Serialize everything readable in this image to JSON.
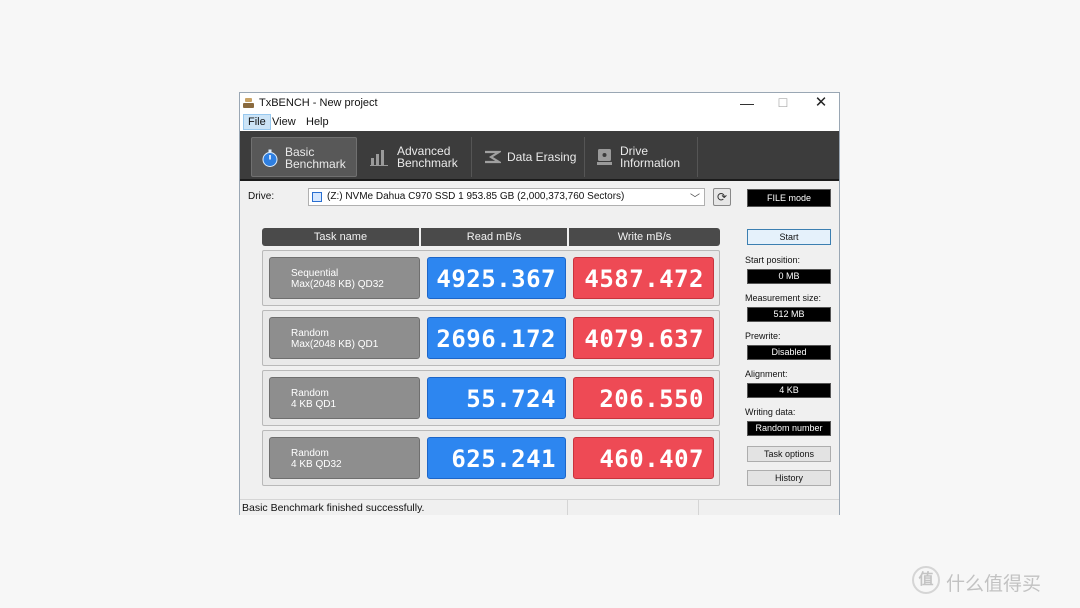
{
  "window": {
    "title": "TxBENCH - New project",
    "minimize": "—",
    "maximize": "☐",
    "close": "✕"
  },
  "menu": [
    "File",
    "View",
    "Help"
  ],
  "tabs": [
    {
      "label": "Basic\nBenchmark",
      "icon": "stopwatch-icon",
      "active": true
    },
    {
      "label": "Advanced\nBenchmark",
      "icon": "bar-chart-icon",
      "active": false
    },
    {
      "label": "Data Erasing",
      "icon": "eraser-icon",
      "active": false
    },
    {
      "label": "Drive\nInformation",
      "icon": "drive-info-icon",
      "active": false
    }
  ],
  "drive": {
    "label": "Drive:",
    "selected": "(Z:) NVMe Dahua C970 SSD 1  953.85 GB (2,000,373,760 Sectors)",
    "refresh_icon": "⟳",
    "mode": "FILE mode"
  },
  "table": {
    "headers": [
      "Task name",
      "Read mB/s",
      "Write mB/s"
    ],
    "rows": [
      {
        "task_line1": "Sequential",
        "task_line2": "Max(2048 KB) QD32",
        "read": "4925.367",
        "write": "4587.472"
      },
      {
        "task_line1": "Random",
        "task_line2": "Max(2048 KB) QD1",
        "read": "2696.172",
        "write": "4079.637"
      },
      {
        "task_line1": "Random",
        "task_line2": "4 KB QD1",
        "read": "55.724",
        "write": "206.550"
      },
      {
        "task_line1": "Random",
        "task_line2": "4 KB QD32",
        "read": "625.241",
        "write": "460.407"
      }
    ]
  },
  "side": {
    "start": "Start",
    "start_position_label": "Start position:",
    "start_position": "0 MB",
    "measurement_size_label": "Measurement size:",
    "measurement_size": "512 MB",
    "prewrite_label": "Prewrite:",
    "prewrite": "Disabled",
    "alignment_label": "Alignment:",
    "alignment": "4 KB",
    "writing_data_label": "Writing data:",
    "writing_data": "Random number",
    "task_options": "Task options",
    "history": "History"
  },
  "status": "Basic Benchmark finished successfully.",
  "watermark": {
    "icon": "值",
    "text": "什么值得买"
  },
  "colors": {
    "read": "#2d86f0",
    "write": "#ee4a55",
    "toolbar": "#3c3c3c"
  }
}
